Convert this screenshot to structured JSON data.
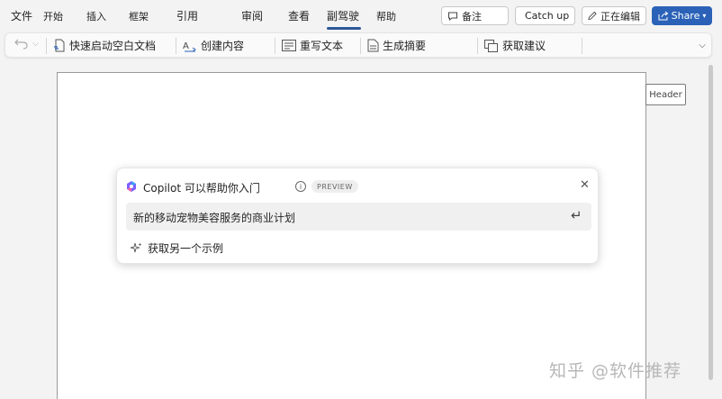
{
  "menu": {
    "items": [
      "文件",
      "开始",
      "插入",
      "框架",
      "引用",
      "审阅",
      "查看",
      "副驾驶",
      "帮助"
    ],
    "active_index": 7
  },
  "top_buttons": {
    "comments": "备注",
    "catch_up": "Catch up",
    "editing": "正在编辑",
    "share": "Share"
  },
  "ribbon": {
    "quick_start": "快速启动空白文档",
    "create_content": "创建内容",
    "rewrite_text": "重写文本",
    "generate_summary": "生成摘要",
    "get_suggestions": "获取建议"
  },
  "page": {
    "header_tag": "Header"
  },
  "copilot": {
    "title": "Copilot 可以帮助你入门",
    "preview_badge": "PREVIEW",
    "prompt": "新的移动宠物美容服务的商业计划",
    "another_example": "获取另一个示例"
  },
  "watermark": "知乎 @软件推荐",
  "colors": {
    "accent": "#2b5797",
    "share_bg": "#2b62b8",
    "page_bg": "#f3f3f3"
  },
  "icons": [
    "undo-icon",
    "quick-doc-icon",
    "create-content-icon",
    "rewrite-icon",
    "summary-icon",
    "suggestions-icon",
    "comment-icon",
    "catch-up-icon",
    "pencil-icon",
    "share-icon",
    "copilot-logo",
    "info-icon",
    "close-icon",
    "enter-icon",
    "sparkle-icon"
  ]
}
